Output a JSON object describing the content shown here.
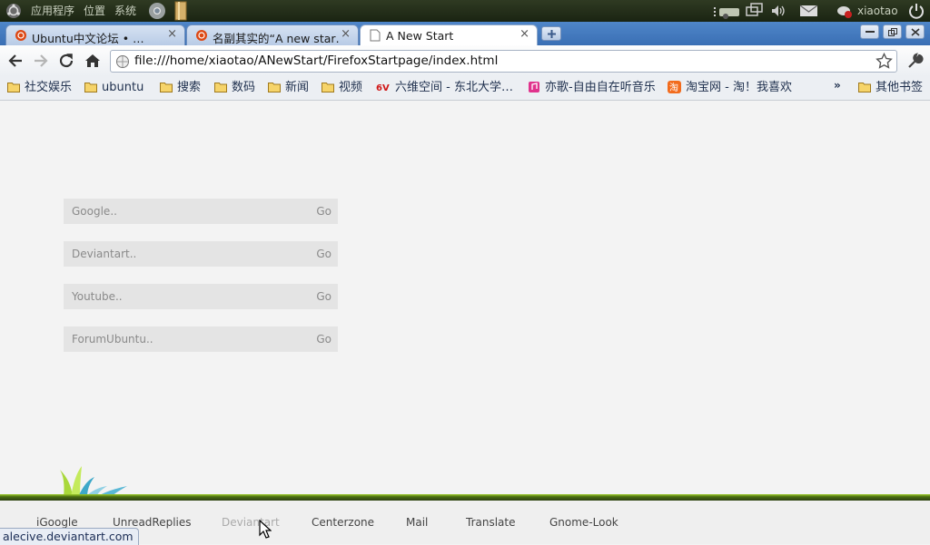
{
  "panel": {
    "apps_menu": "应用程序",
    "places_menu": "位置",
    "system_menu": "系统",
    "username": "xiaotao"
  },
  "tabs": [
    {
      "title": "Ubuntu中文论坛 • …",
      "close": "×"
    },
    {
      "title": "名副其实的“A new star…",
      "close": "×"
    },
    {
      "title": "A New Start",
      "close": "×"
    }
  ],
  "toolbar": {
    "url": "file:///home/xiaotao/ANewStart/FirefoxStartpage/index.html"
  },
  "bookmarks": [
    {
      "label": "社交娱乐",
      "icon": "folder-icon"
    },
    {
      "label": "ubuntu",
      "icon": "folder-icon"
    },
    {
      "label": "搜索",
      "icon": "folder-icon"
    },
    {
      "label": "数码",
      "icon": "folder-icon"
    },
    {
      "label": "新闻",
      "icon": "folder-icon"
    },
    {
      "label": "视频",
      "icon": "folder-icon"
    },
    {
      "label": "六维空间 - 东北大学…",
      "icon": "6v-icon"
    },
    {
      "label": "亦歌-自由自在听音乐",
      "icon": "music-icon"
    },
    {
      "label": "淘宝网 - 淘！我喜欢",
      "icon": "taobao-icon"
    }
  ],
  "bookmarks_overflow": "»",
  "other_bookmarks": "其他书签",
  "search_boxes": [
    {
      "placeholder": "Google..",
      "go": "Go"
    },
    {
      "placeholder": "Deviantart..",
      "go": "Go"
    },
    {
      "placeholder": "Youtube..",
      "go": "Go"
    },
    {
      "placeholder": "ForumUbuntu..",
      "go": "Go"
    }
  ],
  "footer_links": [
    "iGoogle",
    "UnreadReplies",
    "Deviantart",
    "Centerzone",
    "Mail",
    "Translate",
    "Gnome-Look"
  ],
  "status_url": "alecive.deviantart.com",
  "colors": {
    "panel_bg": "#1f2a17",
    "tab_strip": "#4a80c4",
    "accent_green": "#9ccb2a"
  }
}
